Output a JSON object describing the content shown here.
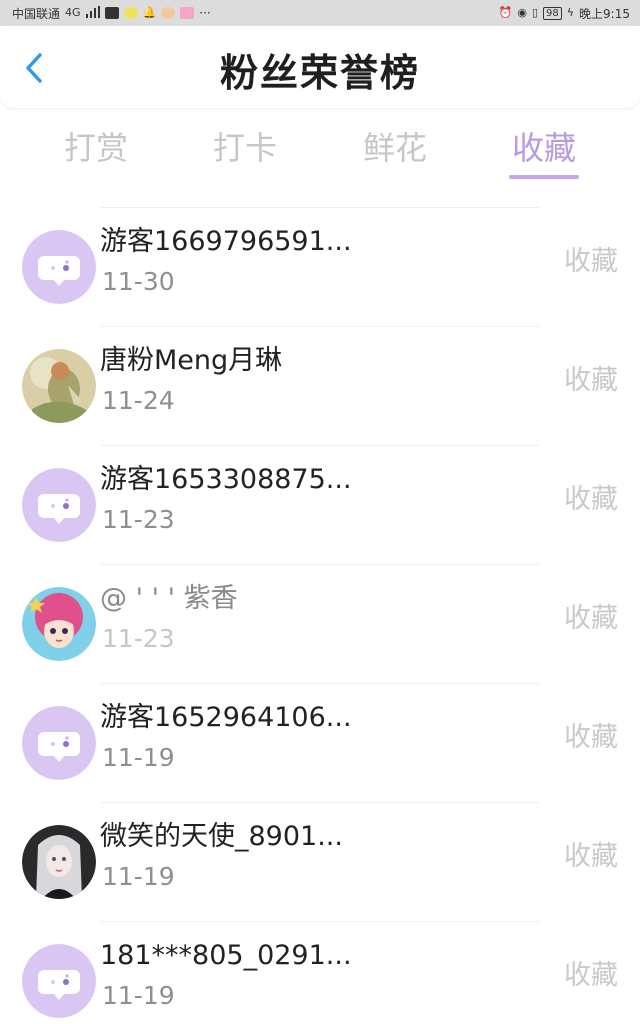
{
  "status_bar": {
    "carrier": "中国联通",
    "network": "4G",
    "more": "···",
    "battery": "98",
    "time": "晚上9:15"
  },
  "header": {
    "title": "粉丝荣誉榜"
  },
  "tabs": [
    {
      "label": "打赏"
    },
    {
      "label": "打卡"
    },
    {
      "label": "鲜花"
    },
    {
      "label": "收藏"
    }
  ],
  "active_tab": "收藏",
  "colors": {
    "accent": "#b79ae0",
    "back_arrow": "#2e9bf0",
    "placeholder_avatar": "#d9c6f2",
    "inactive_text": "#c6c6c6"
  },
  "rows": [
    {
      "name": "游客1669796591...",
      "date": "11-30",
      "action": "收藏",
      "avatar": "chat-bubble-icon"
    },
    {
      "name": "唐粉Meng月琳",
      "date": "11-24",
      "action": "收藏",
      "avatar": "photo"
    },
    {
      "name": "游客1653308875...",
      "date": "11-23",
      "action": "收藏",
      "avatar": "chat-bubble-icon"
    },
    {
      "name": "@ ' ' ' 紫香",
      "date": "11-23",
      "action": "收藏",
      "avatar": "photo"
    },
    {
      "name": "游客1652964106...",
      "date": "11-19",
      "action": "收藏",
      "avatar": "chat-bubble-icon"
    },
    {
      "name": "微笑的天使_8901...",
      "date": "11-19",
      "action": "收藏",
      "avatar": "photo"
    },
    {
      "name": "181***805_0291...",
      "date": "11-19",
      "action": "收藏",
      "avatar": "chat-bubble-icon"
    }
  ]
}
